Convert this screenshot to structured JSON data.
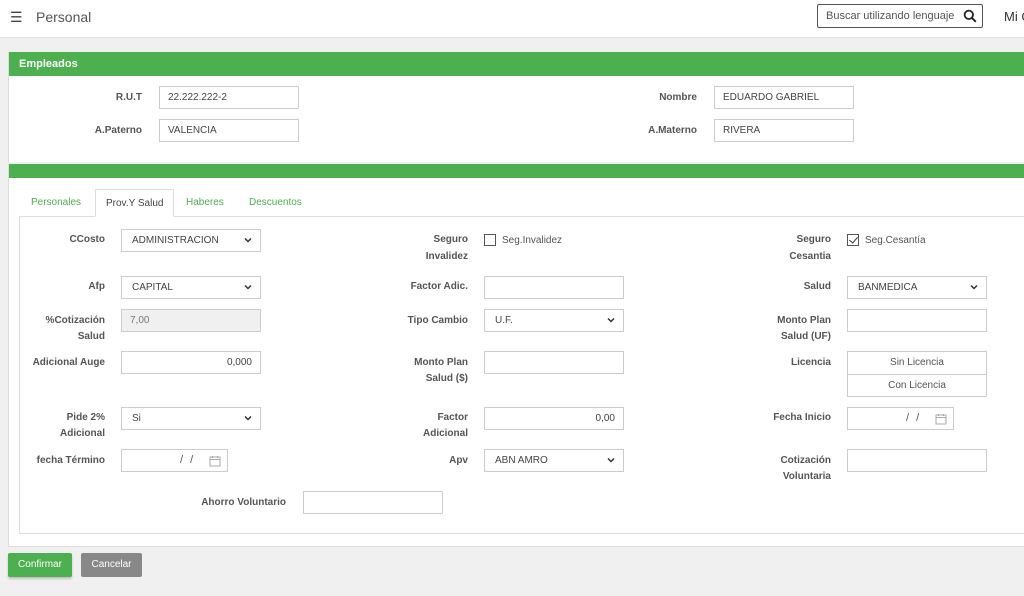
{
  "header": {
    "title": "Personal",
    "search_placeholder": "Buscar utilizando lenguaje",
    "user_label": "Mi C"
  },
  "empleados": {
    "title": "Empleados",
    "rut_label": "R.U.T",
    "rut_value": "22.222.222-2",
    "nombre_label": "Nombre",
    "nombre_value": "EDUARDO GABRIEL",
    "apaterno_label": "A.Paterno",
    "apaterno_value": "VALENCIA",
    "amaterno_label": "A.Materno",
    "amaterno_value": "RIVERA"
  },
  "tabs": [
    {
      "label": "Personales",
      "active": false
    },
    {
      "label": "Prov.Y Salud",
      "active": true
    },
    {
      "label": "Haberes",
      "active": false
    },
    {
      "label": "Descuentos",
      "active": false
    }
  ],
  "form": {
    "ccosto_label": "CCosto",
    "ccosto_value": "ADMINISTRACION",
    "afp_label": "Afp",
    "afp_value": "CAPITAL",
    "cotizacion_label_1": "%Cotización",
    "cotizacion_label_2": "Salud",
    "cotizacion_value": "7,00",
    "adicional_auge_label": "Adicional Auge",
    "adicional_auge_value": "0,000",
    "pide2_label_1": "Pide 2%",
    "pide2_label_2": "Adicional",
    "pide2_value": "Si",
    "fecha_termino_label": "fecha Término",
    "fecha_termino_value": "/ /",
    "ahorro_label": "Ahorro Voluntario",
    "ahorro_value": "",
    "seguro_invalidez_label_1": "Seguro",
    "seguro_invalidez_label_2": "Invalidez",
    "seguro_invalidez_check_label": "Seg.Invalidez",
    "seguro_invalidez_checked": false,
    "factor_adic_label": "Factor Adic.",
    "factor_adic_value": "",
    "tipo_cambio_label": "Tipo Cambio",
    "tipo_cambio_value": "U.F.",
    "monto_plan_label_1": "Monto Plan",
    "monto_plan_label_2": "Salud ($)",
    "monto_plan_value": "",
    "factor_adicional_label_1": "Factor",
    "factor_adicional_label_2": "Adicional",
    "factor_adicional_value": "0,00",
    "apv_label": "Apv",
    "apv_value": "ABN AMRO",
    "seguro_cesantia_label_1": "Seguro",
    "seguro_cesantia_label_2": "Cesantia",
    "seguro_cesantia_check_label": "Seg.Cesantía",
    "seguro_cesantia_checked": true,
    "salud_label": "Salud",
    "salud_value": "BANMEDICA",
    "monto_plan_uf_label_1": "Monto Plan",
    "monto_plan_uf_label_2": "Salud (UF)",
    "monto_plan_uf_value": "",
    "licencia_label": "Licencia",
    "licencia_options": [
      "Sin Licencia",
      "Con Licencia"
    ],
    "fecha_inicio_label": "Fecha Inicio",
    "fecha_inicio_value": "/ /",
    "cotizacion_vol_label_1": "Cotización",
    "cotizacion_vol_label_2": "Voluntaria",
    "cotizacion_vol_value": ""
  },
  "actions": {
    "confirm": "Confirmar",
    "cancel": "Cancelar"
  },
  "colors": {
    "accent": "#4caf50",
    "cancel": "#888888"
  }
}
